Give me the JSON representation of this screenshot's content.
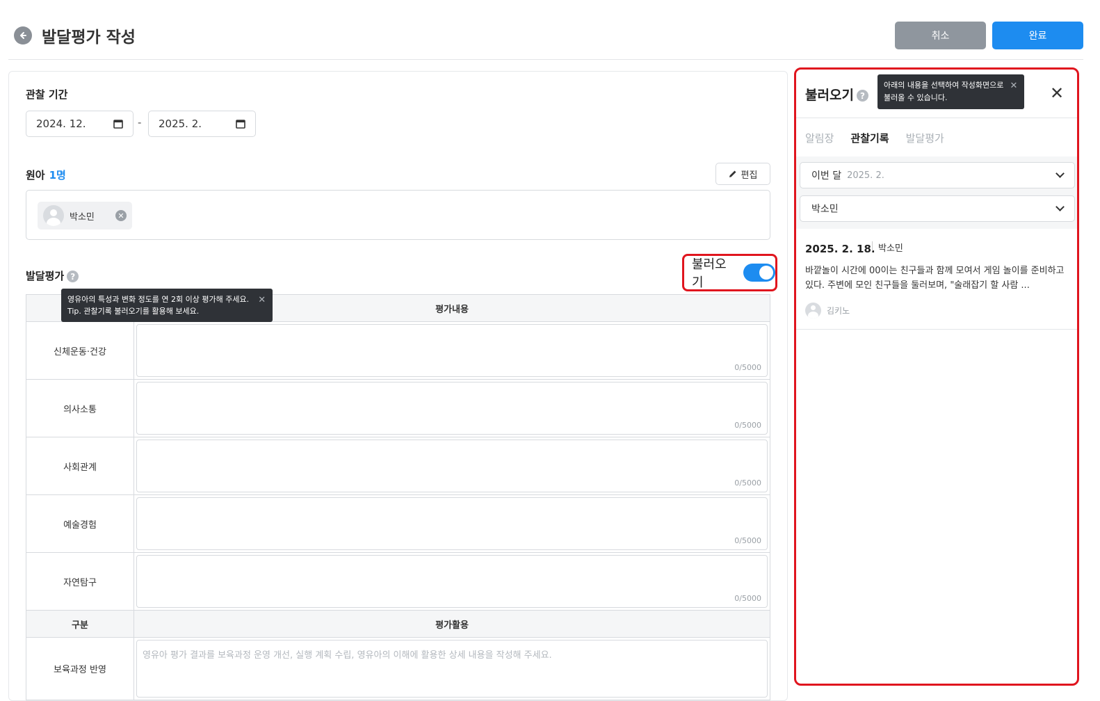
{
  "header": {
    "title": "발달평가 작성",
    "cancel_label": "취소",
    "done_label": "완료"
  },
  "observation": {
    "label": "관찰 기간",
    "start": "2024. 12.",
    "separator": "-",
    "end": "2025. 2."
  },
  "children": {
    "label": "원아",
    "count": "1명",
    "edit_label": "편집",
    "chip_name": "박소민"
  },
  "evaluation": {
    "label": "발달평가",
    "tooltip_line1": "영유아의 특성과 변화 정도를 연 2회 이상 평가해 주세요.",
    "tooltip_line2": "Tip. 관찰기록 불러오기를 활용해 보세요.",
    "toggle_label": "불러오기",
    "toggle_on": true
  },
  "table": {
    "header_content": "평가내용",
    "rows": [
      {
        "label": "신체운동·건강",
        "counter": "0/5000"
      },
      {
        "label": "의사소통",
        "counter": "0/5000"
      },
      {
        "label": "사회관계",
        "counter": "0/5000"
      },
      {
        "label": "예술경험",
        "counter": "0/5000"
      },
      {
        "label": "자연탐구",
        "counter": "0/5000"
      }
    ],
    "usage_header_left": "구분",
    "usage_header_right": "평가활용",
    "usage_row_label": "보육과정 반영",
    "usage_placeholder": "영유아 평가 결과를 보육과정 운영 개선, 실행 계획 수립, 영유아의 이해에 활용한 상세 내용을 작성해 주세요."
  },
  "side_panel": {
    "title": "불러오기",
    "tooltip_line1": "아래의 내용을 선택하여 작성화면으로",
    "tooltip_line2": "불러올 수 있습니다.",
    "tabs": [
      "알림장",
      "관찰기록",
      "발달평가"
    ],
    "active_tab": 1,
    "period_label": "이번 달",
    "period_value": "2025. 2.",
    "child_select": "박소민",
    "record": {
      "date": "2025. 2. 18.",
      "name": "박소민",
      "body": "바깥놀이 시간에 00이는 친구들과 함께 모여서 게임 놀이를 준비하고 있다. 주변에 모인 친구들을 둘러보며, \"술래잡기 할 사람 ...",
      "author": "김키노"
    }
  },
  "colors": {
    "accent": "#1d8cf0",
    "highlight": "#e0151e",
    "cancel": "#8f969e"
  }
}
